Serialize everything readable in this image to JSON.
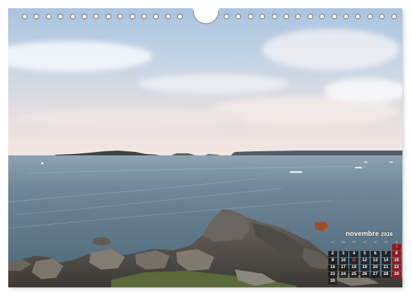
{
  "calendar": {
    "month": "novembre",
    "year": "2026",
    "weekdays": [
      "Lu",
      "Ma",
      "Me",
      "Je",
      "Ve",
      "Sa",
      "Di"
    ],
    "leading_blanks": 6,
    "days": [
      "1",
      "2",
      "3",
      "4",
      "5",
      "6",
      "7",
      "8",
      "9",
      "10",
      "11",
      "12",
      "13",
      "14",
      "15",
      "16",
      "17",
      "18",
      "19",
      "20",
      "21",
      "22",
      "23",
      "24",
      "25",
      "26",
      "27",
      "28",
      "29",
      "30"
    ],
    "holidays": [
      "1",
      "11"
    ]
  },
  "colors": {
    "sky_top": "#b8cde3",
    "sea": "#5e7685",
    "rock": "#5a554f",
    "sunday_cell": "#8d1c1c",
    "holiday_text": "#ff4a4a"
  }
}
